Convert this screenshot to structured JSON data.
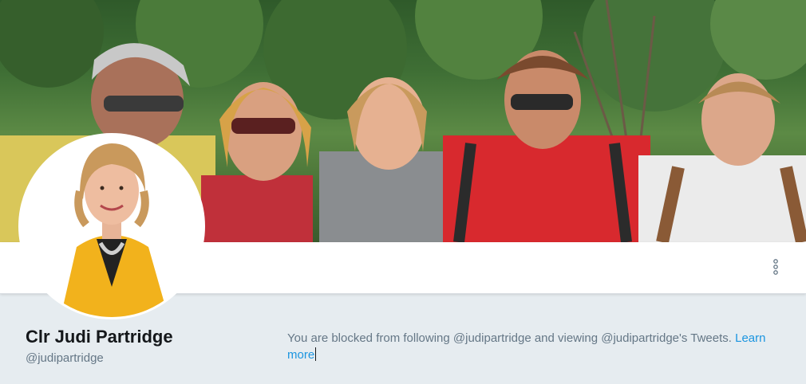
{
  "profile": {
    "name": "Clr Judi Partridge",
    "handle": "@judipartridge"
  },
  "blocked_notice": {
    "text": "You are blocked from following @judipartridge and viewing @judipartridge's Tweets.",
    "link_label": "Learn more"
  },
  "icons": {
    "more": "more-vertical-icon"
  },
  "colors": {
    "link": "#1b95e0",
    "text_primary": "#14171a",
    "text_secondary": "#657786",
    "page_background": "#e6ecf0"
  }
}
